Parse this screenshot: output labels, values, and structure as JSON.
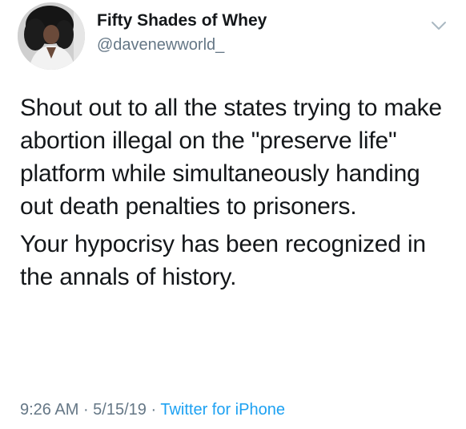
{
  "author": {
    "display_name": "Fifty Shades of Whey",
    "handle": "@davenewworld_"
  },
  "tweet": {
    "paragraphs": [
      "Shout out to all the states trying to make abortion illegal on the \"preserve life\" platform while simultaneously handing out death penalties to prisoners.",
      "Your hypocrisy has been recognized in the annals of history."
    ]
  },
  "meta": {
    "time": "9:26 AM",
    "separator1": " · ",
    "date": "5/15/19",
    "separator2": " · ",
    "source": "Twitter for iPhone"
  },
  "icons": {
    "menu": "chevron-down-icon"
  },
  "colors": {
    "text": "#14171a",
    "secondary": "#657786",
    "link": "#1da1f2",
    "background": "#ffffff"
  }
}
